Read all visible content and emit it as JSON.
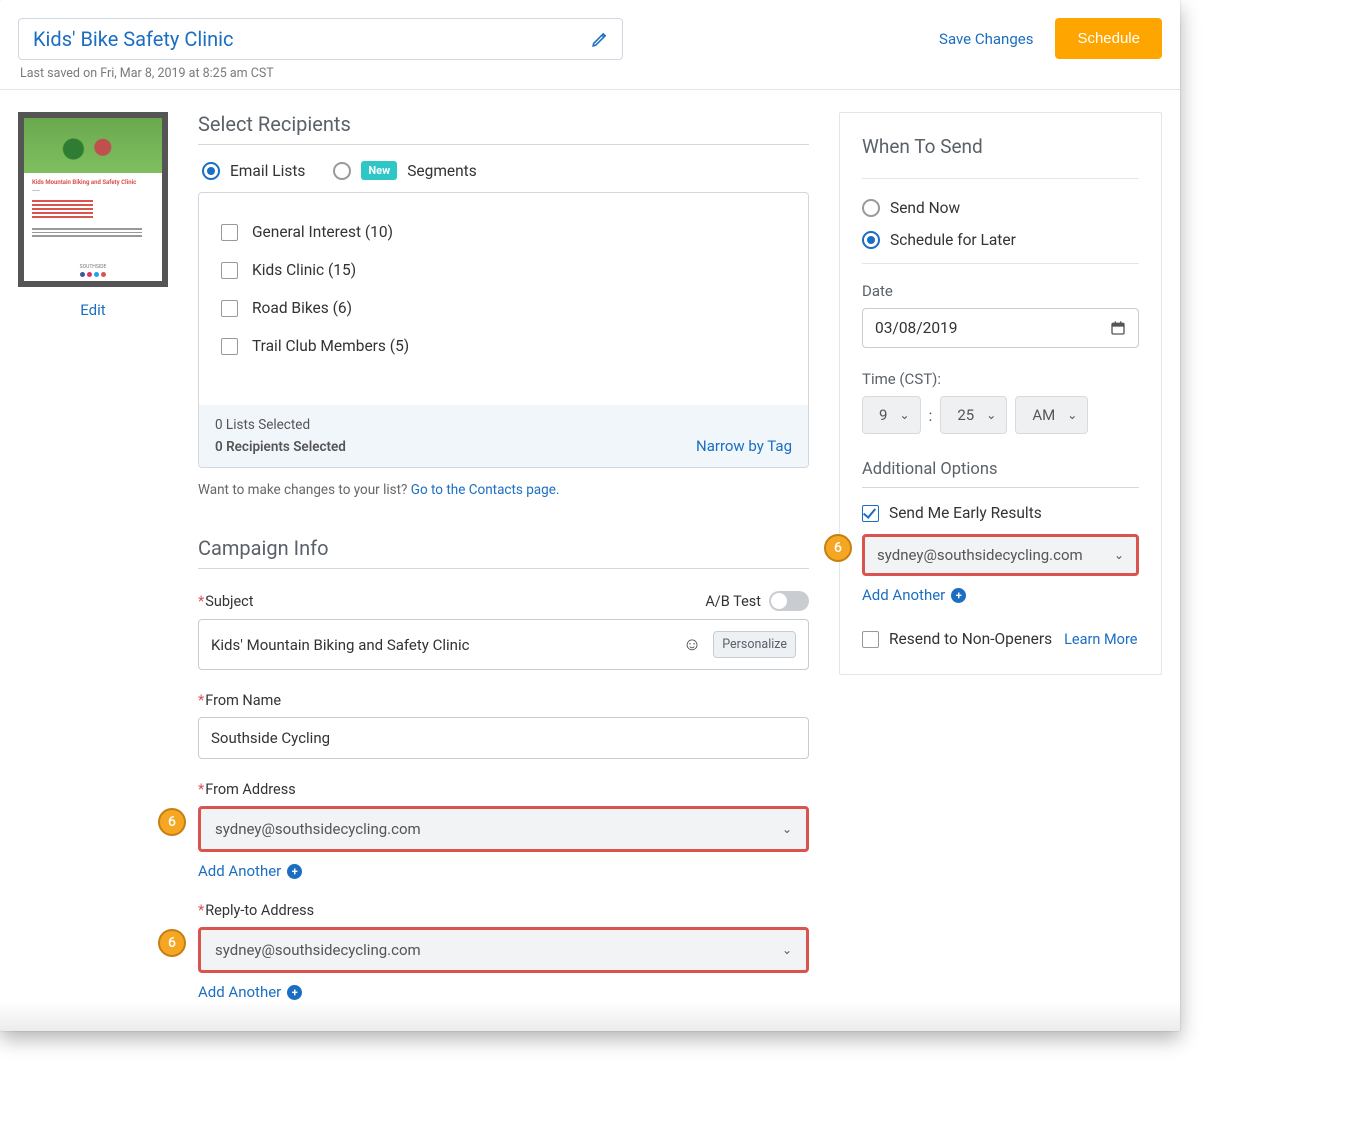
{
  "header": {
    "title": "Kids' Bike Safety Clinic",
    "last_saved": "Last saved on Fri, Mar 8, 2019 at 8:25 am CST",
    "save_changes": "Save Changes",
    "schedule": "Schedule"
  },
  "thumbnail": {
    "edit": "Edit",
    "headline": "Kids Mountain Biking and Safety Clinic"
  },
  "recipients": {
    "title": "Select Recipients",
    "tab_email": "Email Lists",
    "tab_segments": "Segments",
    "badge_new": "New",
    "lists": [
      {
        "label": "General Interest (10)"
      },
      {
        "label": "Kids Clinic (15)"
      },
      {
        "label": "Road Bikes (6)"
      },
      {
        "label": "Trail Club Members (5)"
      }
    ],
    "lists_selected": "0 Lists Selected",
    "recipients_selected": "0 Recipients Selected",
    "narrow": "Narrow by Tag",
    "hint_pre": "Want to make changes to your list? ",
    "hint_link": "Go to the Contacts page."
  },
  "campaign": {
    "title": "Campaign Info",
    "subject_label": "Subject",
    "ab_test": "A/B Test",
    "subject_value": "Kids' Mountain Biking and Safety Clinic",
    "personalize": "Personalize",
    "from_name_label": "From Name",
    "from_name_value": "Southside Cycling",
    "from_addr_label": "From Address",
    "from_addr_value": "sydney@southsidecycling.com",
    "reply_label": "Reply-to Address",
    "reply_value": "sydney@southsidecycling.com",
    "add_another": "Add Another"
  },
  "send": {
    "title": "When To Send",
    "now": "Send Now",
    "later": "Schedule for Later",
    "date_label": "Date",
    "date_value": "03/08/2019",
    "time_label": "Time (CST):",
    "hour": "9",
    "minute": "25",
    "ampm": "AM",
    "additional": "Additional Options",
    "early_results": "Send Me Early Results",
    "early_email": "sydney@southsidecycling.com",
    "add_another": "Add Another",
    "resend": "Resend to Non-Openers",
    "learn_more": "Learn More"
  },
  "step_badge": "6"
}
